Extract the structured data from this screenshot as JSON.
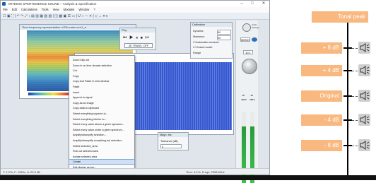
{
  "window": {
    "title": "ARTEMIS SPERTEMENCE SOUND – Analysis & Specification",
    "minimize": "–",
    "maximize": "□",
    "close": "✕"
  },
  "menu": [
    "File",
    "Edit",
    "Calculations",
    "Tools",
    "View",
    "Modules",
    "Window",
    "?"
  ],
  "toolbar_text": "☐ ▣ ⛶ | ↶ ↷ ⤢ ↕ ▤ ▥ ▦ ▧ ▨ | ◫ ▩ ▣ ☰ ▭ | U ∩ ∼ ✕ | ◇ ↔ ▾ ≡",
  "spectrogram": {
    "title": "Time-frequency representation of PA-male-vorn1_a"
  },
  "play_widget": {
    "title": "Play",
    "controls": "⏮ ▶ ⏸ ⏹ ✂",
    "button": "3D TRANS. OFF"
  },
  "calibration": {
    "title": "Calibration",
    "rows": [
      {
        "label": "Dynamic",
        "value": "60"
      },
      {
        "label": "Maximum",
        "value": "90"
      },
      {
        "label": "Automatic measure",
        "value": ""
      },
      {
        "label": "Custom scale",
        "value": ""
      },
      {
        "label": "Range",
        "value": ""
      }
    ]
  },
  "factor_widget": {
    "title": "Magn. tes",
    "label": "Tolerance (dB)",
    "value": "0"
  },
  "level_panel": {
    "audio_settings": "Audio Settings",
    "mode": "MONO",
    "value": "10.1",
    "meter_labels": [
      "-20",
      "-20",
      "dBFS",
      "dBFS"
    ]
  },
  "context_menu": {
    "highlighted_index": 19,
    "items": [
      "Zoom fully out",
      "Zoom in on time domain selection",
      "Cut",
      "Copy",
      "Copy and Paste in new window",
      "Paste",
      "Insert",
      "Append to signal",
      "Copy as an image",
      "Copy data to clipboard",
      "Select everything superior to...",
      "Select everything inferior to...",
      "Select every value above a given spectrum...",
      "Select every value under a given spectrum...",
      "Amplify/deamplify selection...",
      "Amplify/deamplify everything but selection...",
      "Delete selected_area",
      "Rub out selected area",
      "Isolate selected area",
      "Create",
      "Edit display set-up...",
      "Simulation"
    ]
  },
  "status_bar": {
    "left": "T: 2.37s, F: 115Hz, A: 29.5 dB",
    "right": "Time: 4.07s, Freqs: 2598.60Hz"
  },
  "annotation": {
    "peak_label": "Tonal peak",
    "levels": [
      "+ 8 dB",
      "+ 4 dB",
      "Original",
      "- 4 dB",
      "- 8 dB"
    ],
    "colors": {
      "label_bg": "#f8b87f",
      "speaker_bg": "#cfcfcf",
      "axis": "#000000"
    },
    "speaker_icon": "speaker-icon"
  }
}
